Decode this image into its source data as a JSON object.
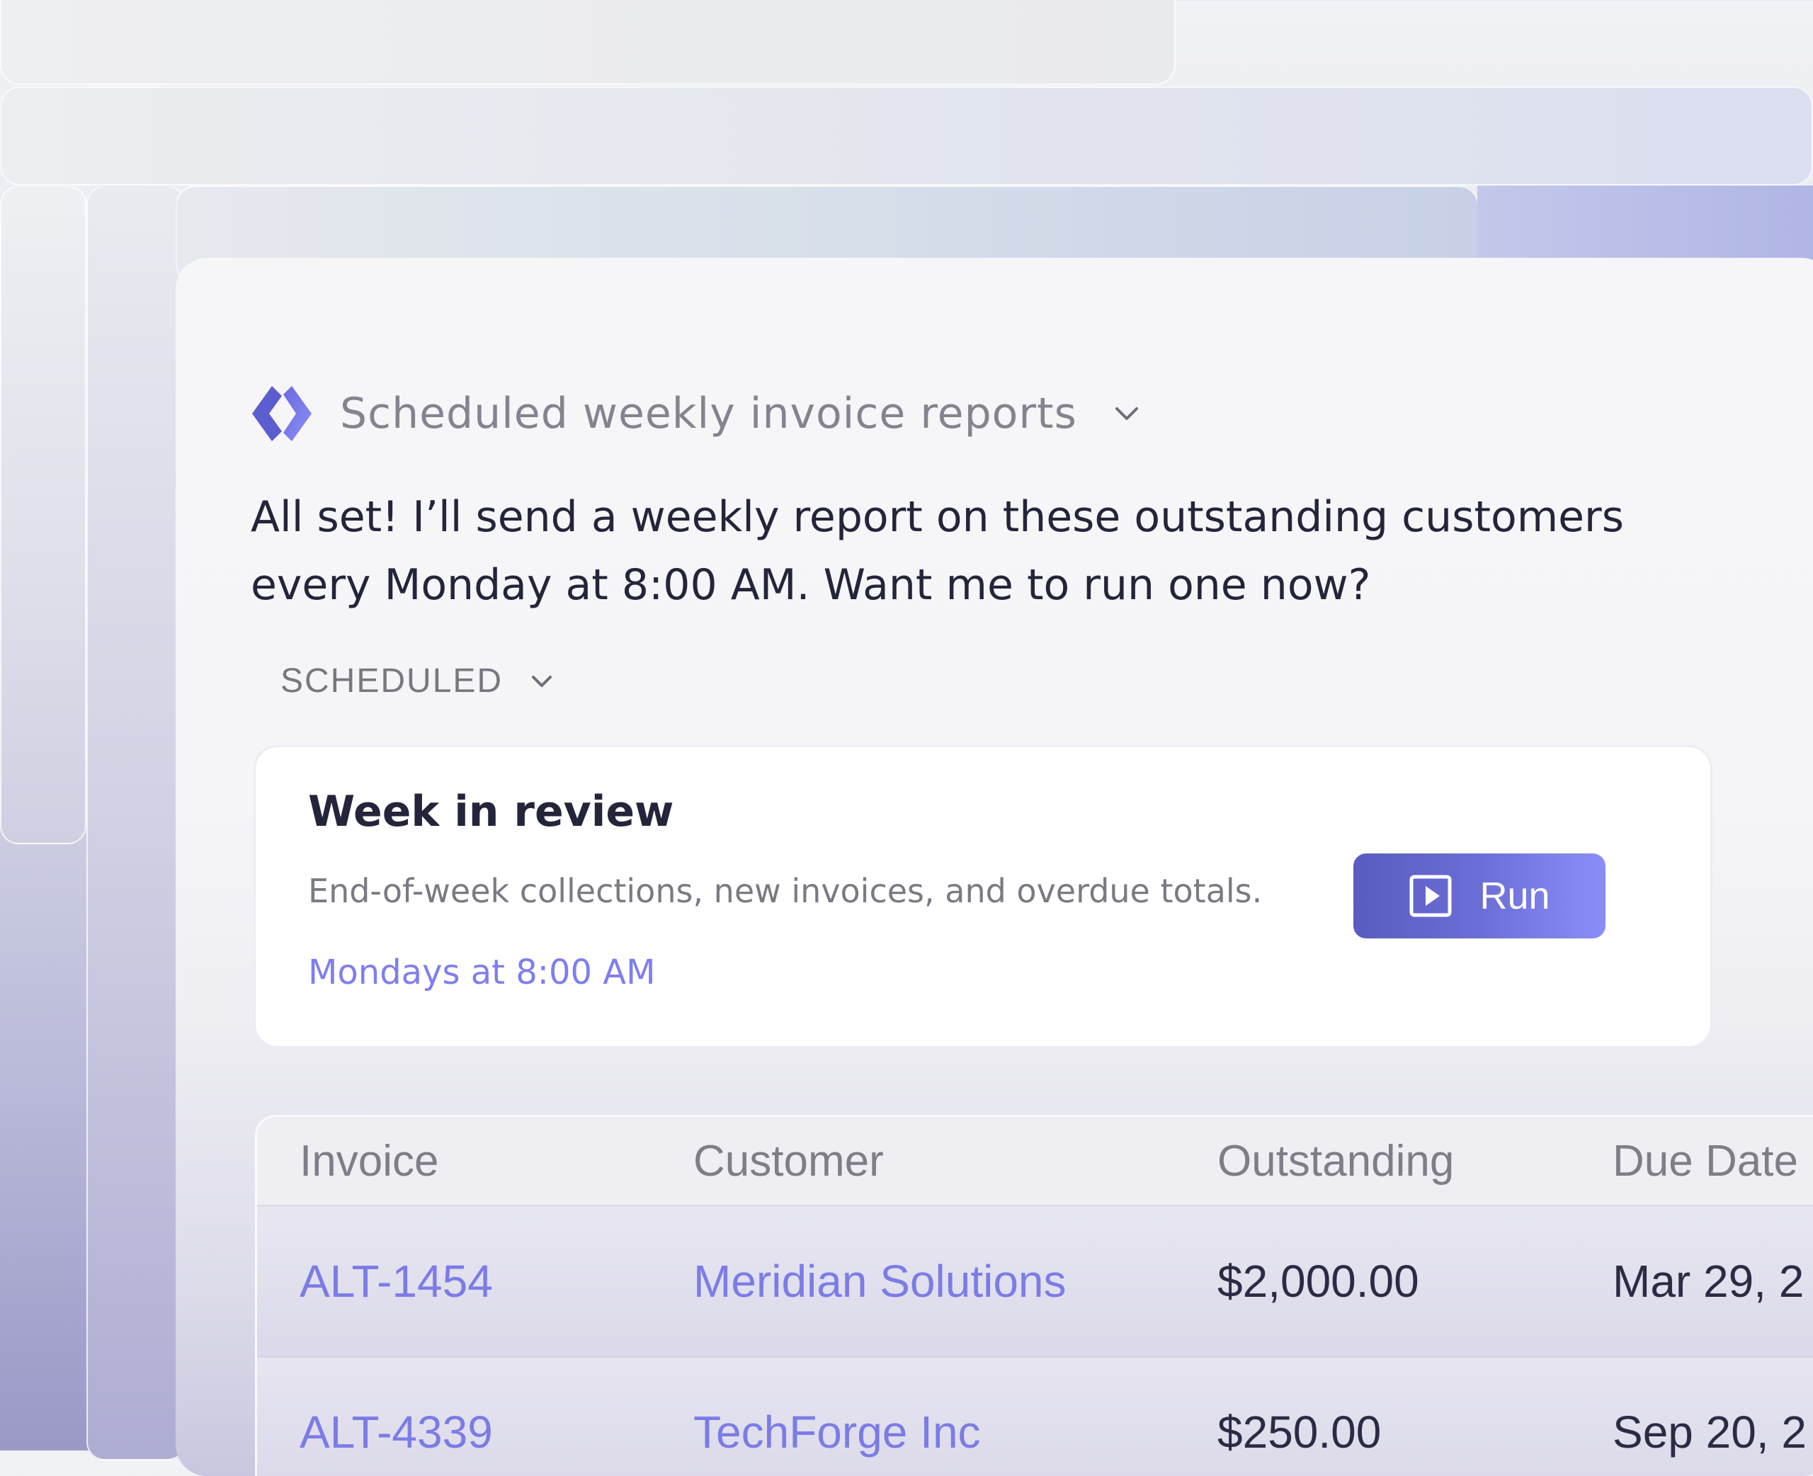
{
  "header": {
    "title": "Scheduled weekly invoice reports"
  },
  "message": {
    "text": "All set! I’ll send a weekly report on these outstanding customers every Monday at 8:00 AM. Want me to run one now?"
  },
  "section": {
    "label": "SCHEDULED"
  },
  "schedule_card": {
    "title": "Week in review",
    "description": "End-of-week collections, new invoices, and overdue totals.",
    "schedule": "Mondays at 8:00 AM",
    "run_label": "Run"
  },
  "table": {
    "headers": {
      "invoice": "Invoice",
      "customer": "Customer",
      "outstanding": "Outstanding",
      "due_date": "Due Date"
    },
    "rows": [
      {
        "invoice": "ALT-1454",
        "customer": "Meridian Solutions",
        "outstanding": "$2,000.00",
        "due_date": "Mar 29, 2"
      },
      {
        "invoice": "ALT-4339",
        "customer": "TechForge Inc",
        "outstanding": "$250.00",
        "due_date": "Sep 20, 2"
      }
    ]
  },
  "colors": {
    "accent": "#7e7ef0",
    "run_button_start": "#5a5bc0",
    "run_button_end": "#8a8ef6",
    "text_primary": "#24243a",
    "text_muted": "#7a7a82"
  },
  "icons": {
    "logo": "diamond-logo-icon",
    "title_chevron": "chevron-down-icon",
    "section_chevron": "chevron-down-icon",
    "run": "play-icon"
  }
}
